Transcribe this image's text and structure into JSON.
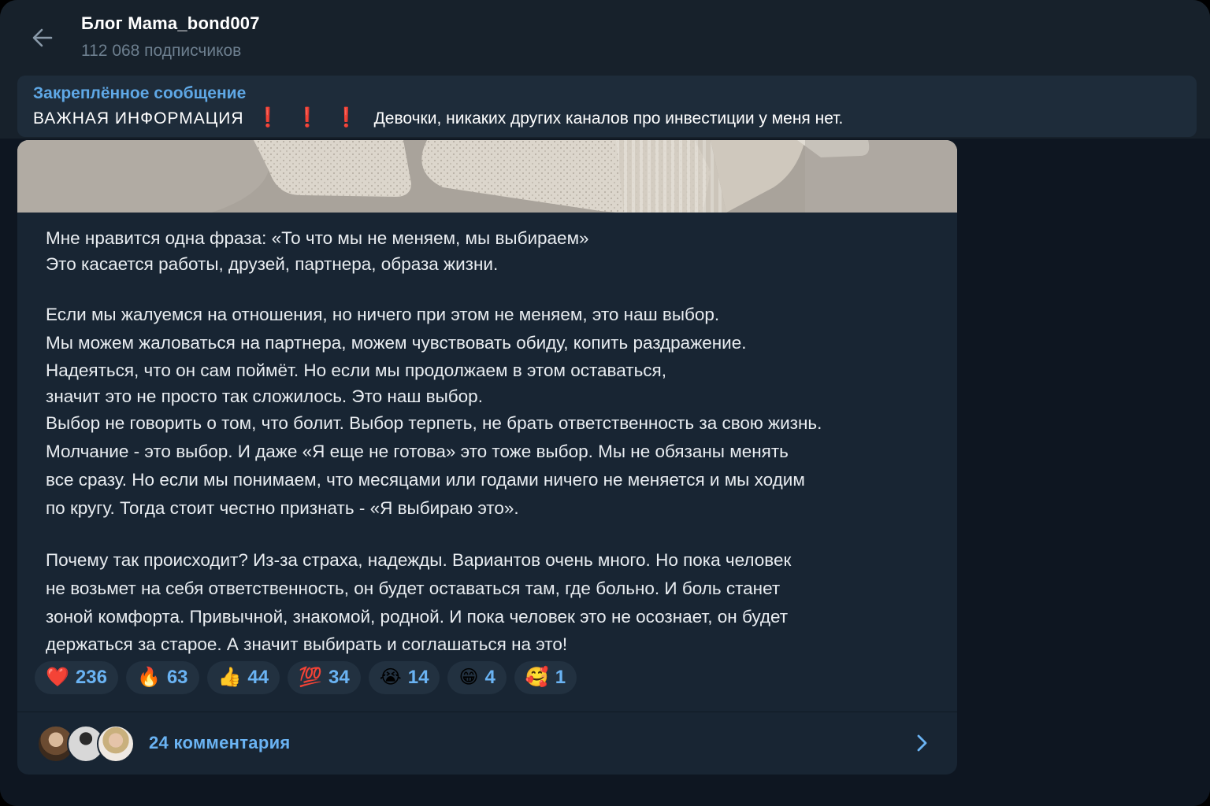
{
  "header": {
    "title": "Блог Mama_bond007",
    "subscribers": "112 068 подписчиков",
    "back_icon": "arrow-left-icon"
  },
  "pinned": {
    "label": "Закреплённое сообщение",
    "caps_text": "ВАЖНАЯ  ИНФОРМАЦИЯ",
    "bang": "❗",
    "text": "Девочки, никаких других каналов про инвестиции у меня нет."
  },
  "post": {
    "paragraph1": [
      "Мне нравится одна фраза: «То что мы не меняем, мы выбираем»",
      "Это касается работы, друзей, партнера, образа жизни."
    ],
    "paragraph2": [
      "Если мы жалуемся на отношения, но ничего при этом не меняем, это наш выбор.",
      "Мы можем жаловаться на партнера, можем чувствовать обиду, копить раздражение.",
      "Надеяться, что он сам поймёт. Но если мы продолжаем в этом оставаться,",
      "значит это не просто так сложилось. Это наш выбор.",
      "Выбор не говорить о том, что болит. Выбор терпеть, не брать ответственность за свою жизнь.",
      "Молчание - это выбор. И даже «Я еще не готова» это тоже выбор. Мы не обязаны менять",
      "все сразу. Но если мы понимаем, что месяцами или годами ничего не меняется и мы ходим",
      "по кругу. Тогда стоит честно признать - «Я выбираю это»."
    ],
    "paragraph3": [
      "Почему так происходит? Из-за страха, надежды. Вариантов очень много. Но пока человек",
      "не возьмет на себя ответственность, он будет оставаться там, где больно. И боль станет",
      "зоной комфорта. Привычной, знакомой, родной. И пока человек это не осознает, он будет",
      "держаться за старое. А значит выбирать и соглашаться на это!"
    ]
  },
  "reactions": [
    {
      "emoji": "❤️",
      "icon": "red-heart-icon",
      "count": "236"
    },
    {
      "emoji": "🔥",
      "icon": "fire-icon",
      "count": "63"
    },
    {
      "emoji": "👍",
      "icon": "thumbs-up-icon",
      "count": "44"
    },
    {
      "emoji": "💯",
      "icon": "hundred-points-icon",
      "count": "34"
    },
    {
      "emoji": "😭",
      "icon": "loudly-crying-face-icon",
      "count": "14"
    },
    {
      "emoji": "😁",
      "icon": "grinning-face-icon",
      "count": "4"
    },
    {
      "emoji": "🥰",
      "icon": "smiling-face-with-hearts-icon",
      "count": "1"
    }
  ],
  "comments": {
    "label": "24 комментария",
    "chevron_icon": "chevron-right-icon"
  },
  "colors": {
    "window_bg": "#17212b",
    "chat_bg": "#0e1621",
    "bubble_bg": "#182533",
    "accent": "#6ab3f3",
    "pinned_label": "#5fa8e6",
    "alert_red": "#e5242c"
  }
}
